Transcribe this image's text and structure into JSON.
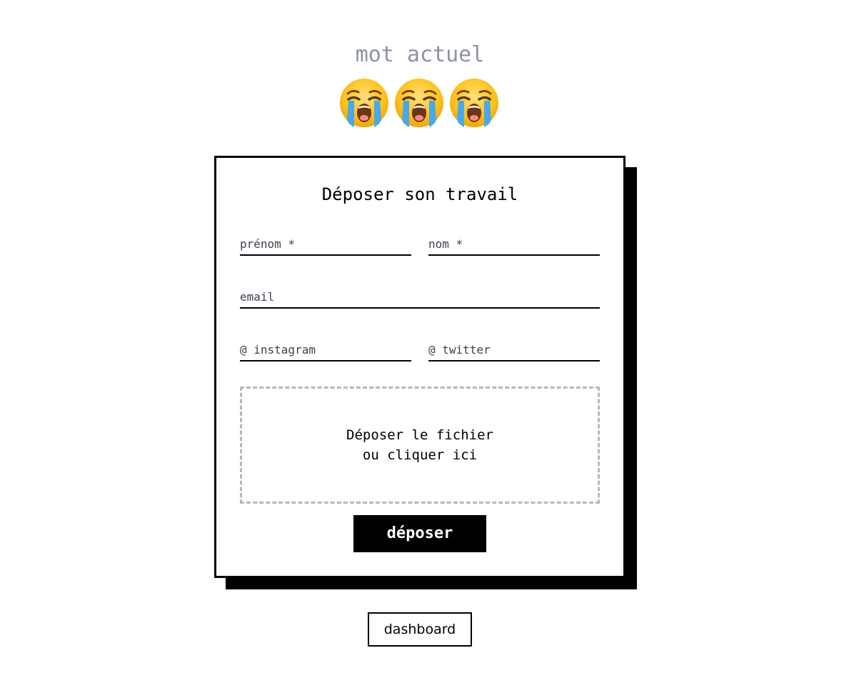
{
  "header": {
    "word_label": "mot actuel",
    "emoji_icons": [
      "loudly-crying-face-icon",
      "loudly-crying-face-icon",
      "loudly-crying-face-icon"
    ]
  },
  "form": {
    "title": "Déposer son travail",
    "fields": {
      "prenom": {
        "placeholder": "prénom *",
        "value": ""
      },
      "nom": {
        "placeholder": "nom *",
        "value": ""
      },
      "email": {
        "placeholder": "email",
        "value": ""
      },
      "instagram": {
        "placeholder": "@ instagram",
        "value": ""
      },
      "twitter": {
        "placeholder": "@ twitter",
        "value": ""
      }
    },
    "dropzone": {
      "line1": "Déposer le fichier",
      "line2": "ou cliquer ici"
    },
    "submit_label": "déposer"
  },
  "footer": {
    "dashboard_label": "dashboard"
  },
  "colors": {
    "accent": "#000000",
    "muted_text": "#8c93a0",
    "dropzone_border": "#b8b8b8",
    "emoji_face": "#fcc21b",
    "emoji_tears": "#4aa8e8"
  }
}
